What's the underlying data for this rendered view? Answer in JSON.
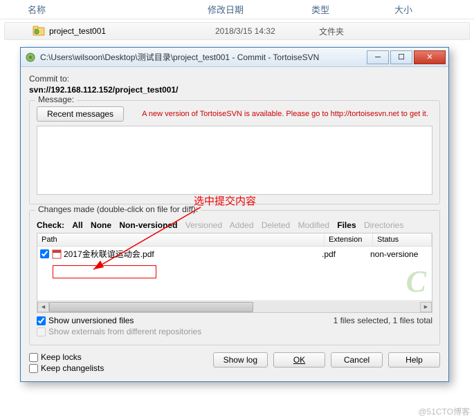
{
  "explorer": {
    "headers": {
      "name": "名称",
      "date": "修改日期",
      "type": "类型",
      "size": "大小"
    },
    "row": {
      "name": "project_test001",
      "date": "2018/3/15 14:32",
      "type": "文件夹"
    }
  },
  "dialog": {
    "title": "C:\\Users\\wilsoon\\Desktop\\测试目录\\project_test001 - Commit - TortoiseSVN",
    "commit_to_label": "Commit to:",
    "svn_url": "svn://192.168.112.152/project_test001/",
    "message_label": "Message:",
    "recent_btn": "Recent messages",
    "notice": "A new version of TortoiseSVN is available. Please go to http://tortoisesvn.net to get it.",
    "changes_label": "Changes made (double-click on file for diff):",
    "check_label": "Check:",
    "filters": {
      "all": "All",
      "none": "None",
      "nonversioned": "Non-versioned",
      "versioned": "Versioned",
      "added": "Added",
      "deleted": "Deleted",
      "modified": "Modified",
      "files": "Files",
      "directories": "Directories"
    },
    "columns": {
      "path": "Path",
      "ext": "Extension",
      "status": "Status"
    },
    "file": {
      "name": "2017金秋联谊运动会.pdf",
      "ext": ".pdf",
      "status": "non-versione"
    },
    "show_unversioned": "Show unversioned files",
    "show_externals": "Show externals from different repositories",
    "stats": "1 files selected, 1 files total",
    "keep_locks": "Keep locks",
    "keep_changelists": "Keep changelists",
    "buttons": {
      "showlog": "Show log",
      "ok": "OK",
      "cancel": "Cancel",
      "help": "Help"
    }
  },
  "annotation": "选中提交内容",
  "page_watermark": "@51CTO博客"
}
